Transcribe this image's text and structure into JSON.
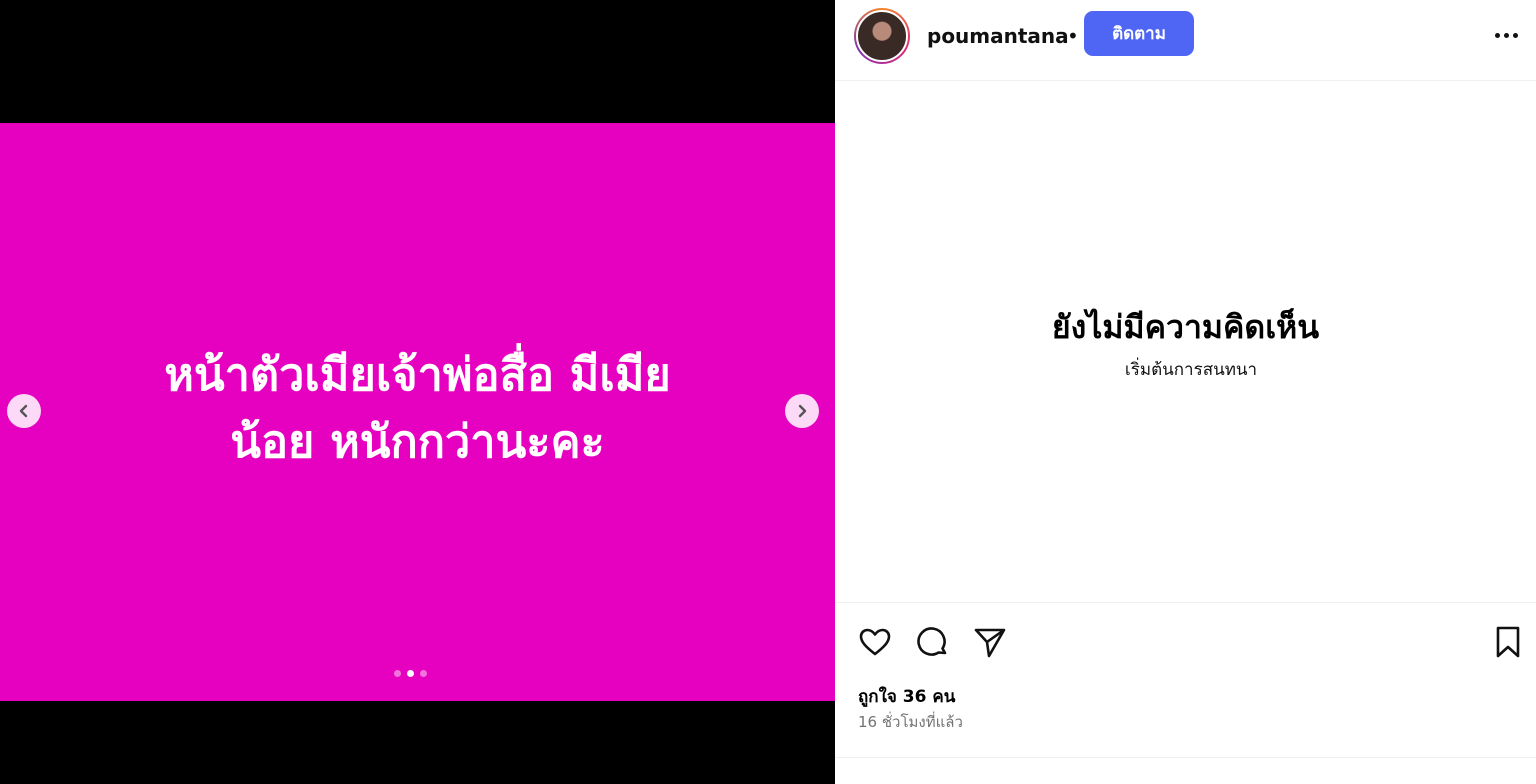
{
  "post": {
    "slide_text": "หน้าตัวเมียเจ้าพ่อสื่อ มีเมีย\nน้อย หนักกว่านะคะ",
    "slide_color": "#e600bf",
    "slide_index": 2,
    "slide_count": 3
  },
  "header": {
    "username": "poumantana",
    "separator": "•",
    "follow_label": "ติดตาม"
  },
  "comments": {
    "empty_title": "ยังไม่มีความคิดเห็น",
    "empty_subtitle": "เริ่มต้นการสนทนา"
  },
  "footer": {
    "likes": "ถูกใจ 36 คน",
    "timestamp": "16 ชั่วโมงที่แล้ว"
  },
  "icons": {
    "prev": "chevron-left-icon",
    "next": "chevron-right-icon",
    "like": "heart-icon",
    "comment": "comment-icon",
    "share": "paper-plane-icon",
    "save": "bookmark-icon",
    "more": "more-horizontal-icon"
  },
  "colors": {
    "accent": "#4f66f5"
  }
}
